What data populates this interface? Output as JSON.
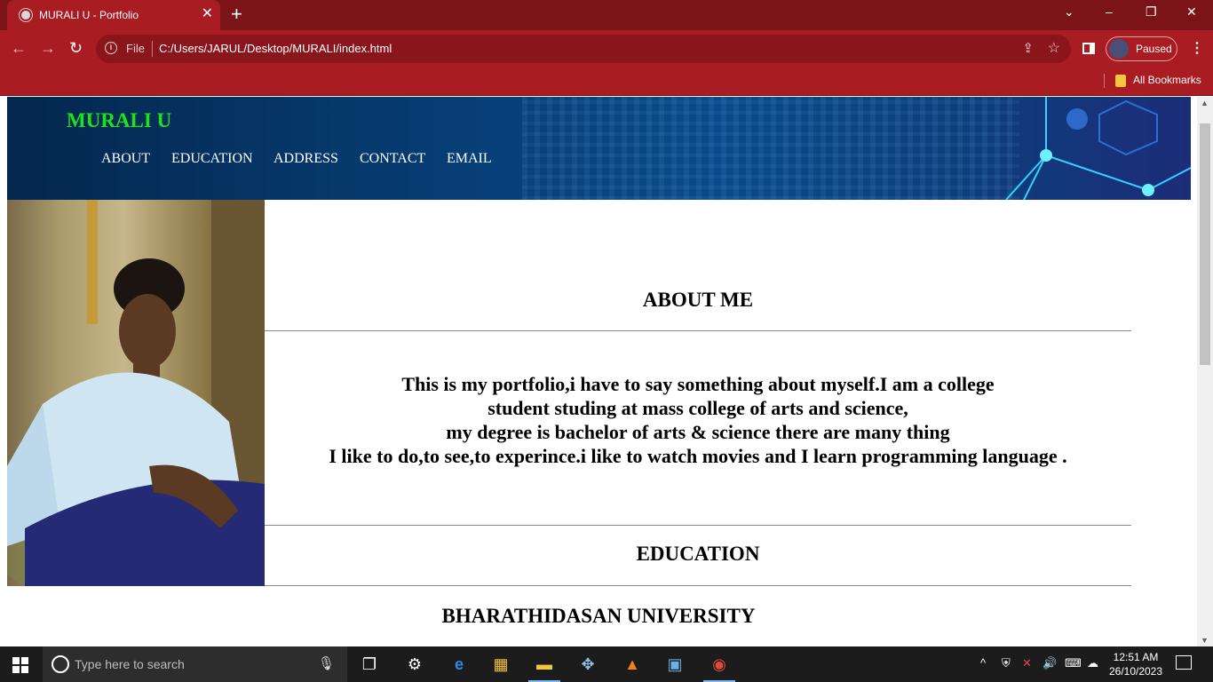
{
  "browser": {
    "tab_title": "MURALI U - Portfolio",
    "tab_close": "✕",
    "new_tab": "+",
    "window_controls": [
      "⌄",
      "–",
      "❐",
      "✕"
    ],
    "url_scheme_label": "File",
    "url": "C:/Users/JARUL/Desktop/MURALI/index.html",
    "profile_label": "Paused",
    "bookmarks_label": "All Bookmarks"
  },
  "site": {
    "brand": "MURALI U",
    "nav": [
      "ABOUT",
      "EDUCATION",
      "ADDRESS",
      "CONTACT",
      "EMAIL"
    ],
    "about_heading": "ABOUT ME",
    "about_lines": [
      "This is my portfolio,i have to say something about myself.I am a college",
      "student studing at mass college of arts and science,",
      "my degree is bachelor of arts & science there are many thing",
      "I like to do,to see,to experince.i like to watch movies and I learn programming language ."
    ],
    "education_heading": "EDUCATION",
    "university": "BHARATHIDASAN UNIVERSITY"
  },
  "taskbar": {
    "search_placeholder": "Type here to search",
    "time": "12:51 AM",
    "date": "26/10/2023"
  },
  "colors": {
    "chrome_accent": "#a81c22",
    "brand_green": "#19e619",
    "hero_blue": "#063c72"
  }
}
